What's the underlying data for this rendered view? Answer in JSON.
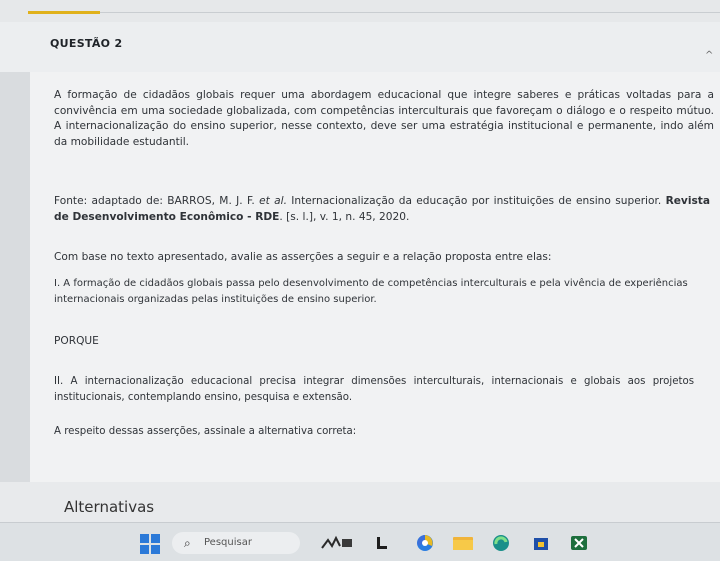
{
  "question": {
    "title": "QUESTÃO 2",
    "collapse_symbol": "^"
  },
  "content": {
    "paragraph1": "A formação de cidadãos globais requer uma abordagem educacional que integre saberes e práticas voltadas para a convivência em uma sociedade globalizada, com competências interculturais que favoreçam o diálogo e o respeito mútuo. A internacionalização do ensino superior, nesse contexto, deve ser uma estratégia institucional e permanente, indo além da mobilidade estudantil.",
    "source_prefix": "Fonte: adaptado de: BARROS, M. J. F. ",
    "source_et_al": "et al.",
    "source_middle": " Internacionalização da educação por instituições de ensino superior. ",
    "source_journal": "Revista de Desenvolvimento Econômico - RDE",
    "source_suffix": ". [s. l.], v. 1, n. 45, 2020.",
    "instruction": "Com base no texto apresentado, avalie as asserções a seguir e a relação proposta entre elas:",
    "assertion1": "I. A formação de cidadãos globais passa pelo desenvolvimento de competências interculturais e pela vivência de experiências internacionais organizadas pelas instituições de ensino superior.",
    "connector": "PORQUE",
    "assertion2": "II. A internacionalização educacional precisa integrar dimensões interculturais, internacionais e globais aos projetos institucionais, contemplando ensino, pesquisa e extensão.",
    "prompt": "A respeito dessas asserções, assinale a alternativa correta:"
  },
  "alternatives": {
    "title": "Alternativas"
  },
  "taskbar": {
    "search_placeholder": "Pesquisar",
    "icons": [
      "windows-start-icon",
      "search-icon",
      "widgets-icon",
      "task-view-icon",
      "chrome-icon",
      "file-explorer-icon",
      "edge-icon",
      "store-icon",
      "excel-icon"
    ]
  },
  "colors": {
    "accent": "#e0b11b",
    "windows_blue": "#2b79d8"
  }
}
